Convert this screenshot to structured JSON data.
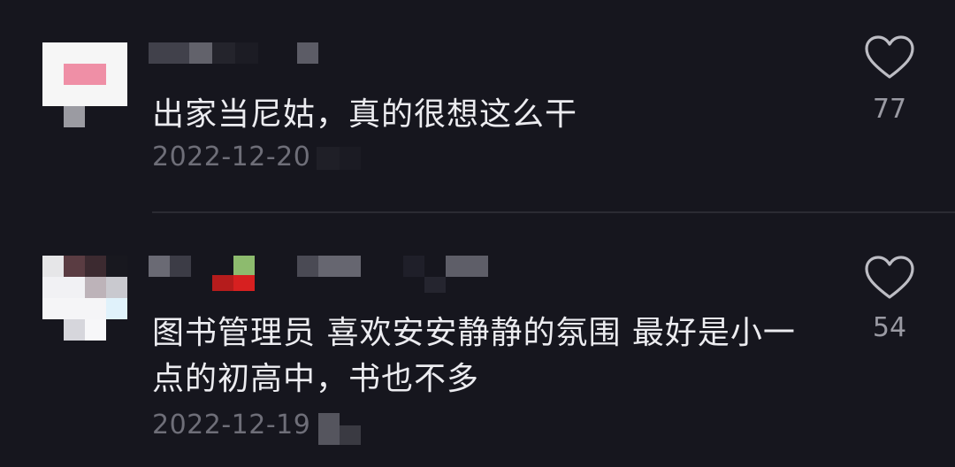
{
  "comments": [
    {
      "text": "出家当尼姑，真的很想这么干",
      "date": "2022-12-20",
      "likes": "77"
    },
    {
      "text": "图书管理员 喜欢安安静静的氛围 最好是小一点的初高中，书也不多",
      "date": "2022-12-19",
      "likes": "54"
    }
  ],
  "icons": {
    "like": "heart-outline-icon"
  },
  "colors": {
    "background": "#16161e",
    "text": "#ececf0",
    "muted": "#6e6e78"
  }
}
